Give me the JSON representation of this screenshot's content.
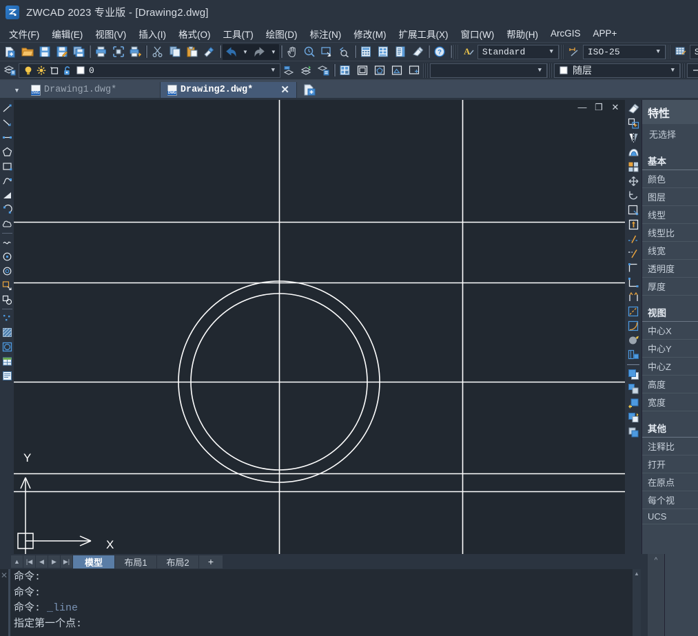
{
  "window": {
    "title": "ZWCAD 2023 专业版 - [Drawing2.dwg]",
    "logo_glyph": "Ƶ",
    "minimize": "—",
    "restore": "❐",
    "close": "✕"
  },
  "menubar": {
    "items": [
      {
        "label": "文件(F)",
        "name": "menu-file"
      },
      {
        "label": "编辑(E)",
        "name": "menu-edit"
      },
      {
        "label": "视图(V)",
        "name": "menu-view"
      },
      {
        "label": "插入(I)",
        "name": "menu-insert"
      },
      {
        "label": "格式(O)",
        "name": "menu-format"
      },
      {
        "label": "工具(T)",
        "name": "menu-tools"
      },
      {
        "label": "绘图(D)",
        "name": "menu-draw"
      },
      {
        "label": "标注(N)",
        "name": "menu-dimension"
      },
      {
        "label": "修改(M)",
        "name": "menu-modify"
      },
      {
        "label": "扩展工具(X)",
        "name": "menu-express-tools"
      },
      {
        "label": "窗口(W)",
        "name": "menu-window"
      },
      {
        "label": "帮助(H)",
        "name": "menu-help"
      },
      {
        "label": "ArcGIS",
        "name": "menu-arcgis"
      },
      {
        "label": "APP+",
        "name": "menu-app-plus"
      }
    ]
  },
  "toolbar_standard": {
    "text_style": "Standard",
    "dim_style": "ISO-25",
    "table_style": "Stan",
    "icons": [
      "new-file-icon",
      "open-folder-icon",
      "save-icon",
      "save-as-icon",
      "save-all-icon",
      "print-icon",
      "print-preview-icon",
      "plot-icon",
      "cut-icon",
      "copy-icon",
      "paste-icon",
      "match-properties-icon",
      "undo-icon",
      "redo-icon",
      "pan-icon",
      "zoom-realtime-icon",
      "zoom-window-icon",
      "zoom-previous-icon",
      "calculator-icon",
      "design-center-icon",
      "tool-palette-icon",
      "eraser-tool-icon",
      "help-icon"
    ]
  },
  "toolbar_layer": {
    "layer_name": "0",
    "color_value": "随层",
    "linetype_value": "",
    "lineweight_value": "",
    "icons": [
      "layer-properties-icon",
      "layer-on-icon",
      "layer-freeze-icon",
      "layer-new-vp-icon",
      "layer-unlock-icon",
      "layer-color-swatch",
      "layer-previous-icon",
      "layer-make-current-icon",
      "layer-match-icon",
      "layer-states-icon"
    ]
  },
  "doctabs": {
    "tabs": [
      {
        "label": "Drawing1.dwg*",
        "active": false,
        "name": "doc-tab-drawing1"
      },
      {
        "label": "Drawing2.dwg*",
        "active": true,
        "name": "doc-tab-drawing2"
      }
    ],
    "close_glyph": "✕",
    "new_tab_glyph": "+"
  },
  "canvas": {
    "background": "#212830",
    "ucs_x_label": "X",
    "ucs_y_label": "Y",
    "entities": "two concentric circles with horizontal and vertical construction lines"
  },
  "properties_panel": {
    "title": "特性",
    "selection": "无选择",
    "groups": [
      {
        "header": "基本",
        "rows": [
          "颜色",
          "图层",
          "线型",
          "线型比",
          "线宽",
          "透明度",
          "厚度"
        ]
      },
      {
        "header": "视图",
        "rows": [
          "中心X",
          "中心Y",
          "中心Z",
          "高度",
          "宽度"
        ]
      },
      {
        "header": "其他",
        "rows": [
          "注释比",
          "打开",
          "在原点",
          "每个视",
          "UCS"
        ]
      }
    ]
  },
  "layout_tabs": {
    "nav": [
      "▲",
      "|◀",
      "◀",
      "▶",
      "▶|"
    ],
    "tabs": [
      {
        "label": "模型",
        "active": true,
        "name": "layout-tab-model"
      },
      {
        "label": "布局1",
        "active": false,
        "name": "layout-tab-layout1"
      },
      {
        "label": "布局2",
        "active": false,
        "name": "layout-tab-layout2"
      }
    ],
    "add_label": "+"
  },
  "command_line": {
    "close_glyph": "✕",
    "lines": [
      {
        "prompt": "命令:",
        "arg": ""
      },
      {
        "prompt": "命令:",
        "arg": ""
      },
      {
        "prompt": "命令:",
        "arg": " _line"
      },
      {
        "prompt": "指定第一个点:",
        "arg": ""
      }
    ],
    "scroll_up": "▲"
  },
  "colors": {
    "chrome": "#2b3440",
    "panel": "#3b4653",
    "canvas": "#212830",
    "accent": "#5a7da6",
    "geometry": "#ffffff"
  }
}
